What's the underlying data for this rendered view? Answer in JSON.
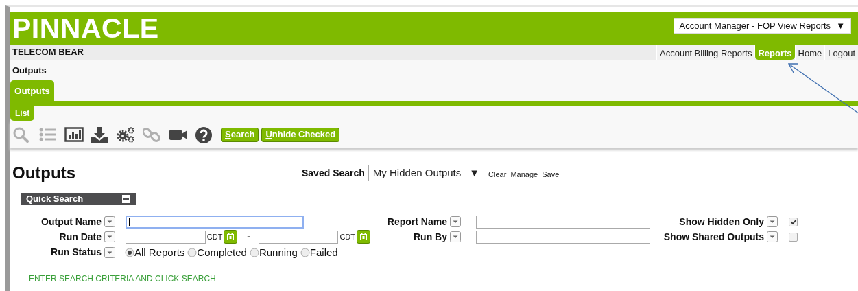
{
  "header": {
    "logo": "PINNACLE",
    "role_select": {
      "value": "Account Manager - FOP View Reports",
      "caret": "▼"
    }
  },
  "company": "TELECOM BEAR",
  "nav": [
    {
      "label": "Account Billing Reports",
      "selected": false
    },
    {
      "label": "Reports",
      "selected": true
    },
    {
      "label": "Home",
      "selected": false
    },
    {
      "label": "Logout",
      "selected": false
    }
  ],
  "breadcrumb": "Outputs",
  "tabs": [
    {
      "label": "Outputs",
      "selected": true
    }
  ],
  "subtabs": [
    {
      "label": "List",
      "selected": true
    }
  ],
  "toolbar": {
    "icons": [
      {
        "kind": "search",
        "disabled": true
      },
      {
        "kind": "list",
        "disabled": true
      },
      {
        "kind": "chart",
        "disabled": false
      },
      {
        "kind": "download",
        "disabled": false
      },
      {
        "kind": "gears",
        "disabled": false
      },
      {
        "kind": "link",
        "disabled": true
      },
      {
        "kind": "video",
        "disabled": false
      },
      {
        "kind": "help",
        "disabled": false
      }
    ],
    "buttons": [
      "Search",
      "Unhide Checked"
    ]
  },
  "page_title": "Outputs",
  "saved_search": {
    "label": "Saved Search",
    "value": "My Hidden Outputs",
    "caret": "▼",
    "links": [
      "Clear",
      "Manage",
      "Save"
    ]
  },
  "quick_search": {
    "title": "Quick Search",
    "expanded": true
  },
  "rows": [
    [
      {
        "kind": "text",
        "label": "Output Name",
        "focused": true
      },
      {
        "kind": "text",
        "label": "Report Name",
        "focused": false
      },
      {
        "kind": "checkbox",
        "label": "Show Hidden Only",
        "checked": true
      }
    ],
    [
      {
        "kind": "daterange",
        "label": "Run Date",
        "zone_from": "CDT",
        "separator": "-",
        "zone_to": "CDT"
      },
      {
        "kind": "text",
        "label": "Run By",
        "focused": false
      },
      {
        "kind": "checkbox",
        "label": "Show Shared Outputs",
        "checked": false
      }
    ],
    [
      {
        "kind": "radios",
        "label": "Run Status",
        "options": [
          {
            "label": "All Reports",
            "selected": true
          },
          {
            "label": "Completed",
            "selected": false
          },
          {
            "label": "Running",
            "selected": false
          },
          {
            "label": "Failed",
            "selected": false
          }
        ]
      }
    ]
  ],
  "hint": "ENTER SEARCH CRITERIA AND CLICK SEARCH"
}
